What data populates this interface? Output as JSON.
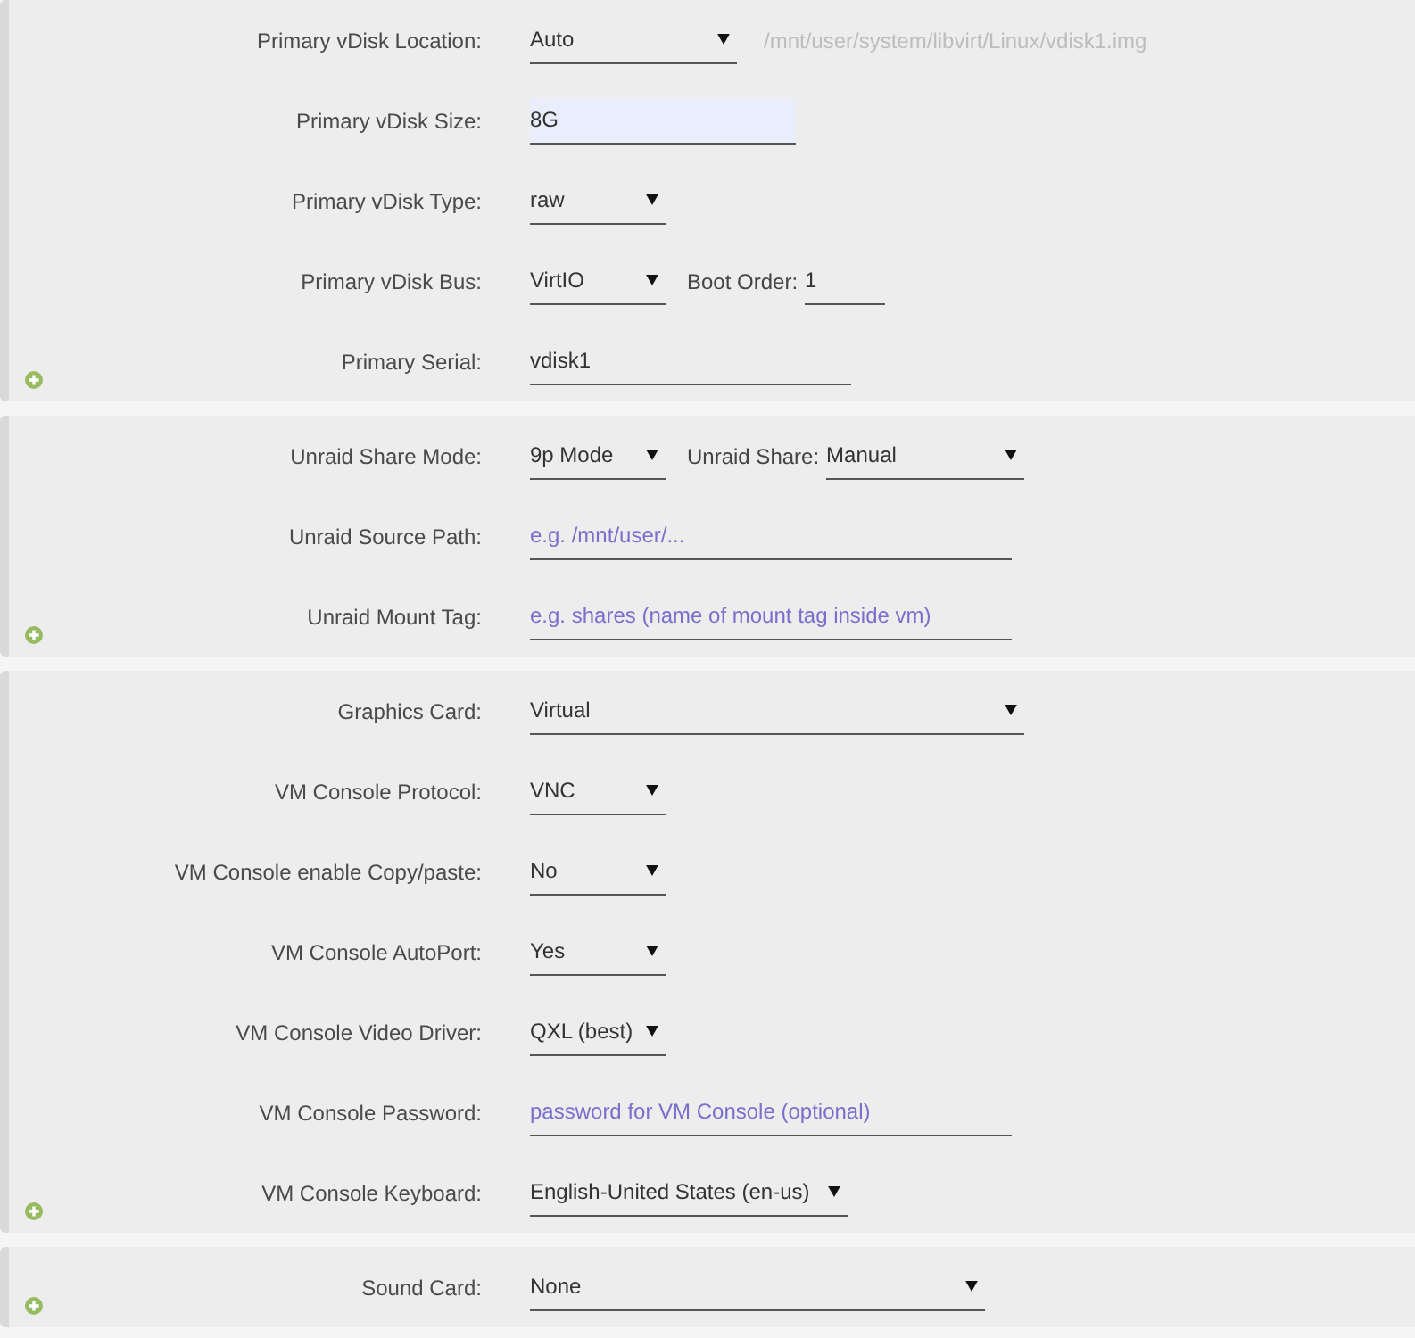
{
  "sections": [
    {
      "rows": [
        {
          "label": "Primary vDisk Location:",
          "controls": [
            {
              "kind": "select",
              "value": "Auto"
            },
            {
              "kind": "note",
              "text": "/mnt/user/system/libvirt/Linux/vdisk1.img"
            }
          ]
        },
        {
          "label": "Primary vDisk Size:",
          "controls": [
            {
              "kind": "input",
              "value": "8G",
              "highlighted": true
            }
          ]
        },
        {
          "label": "Primary vDisk Type:",
          "controls": [
            {
              "kind": "select",
              "value": "raw"
            }
          ]
        },
        {
          "label": "Primary vDisk Bus:",
          "controls": [
            {
              "kind": "select",
              "value": "VirtIO"
            },
            {
              "kind": "label",
              "text": "Boot Order:"
            },
            {
              "kind": "input",
              "value": "1",
              "highlighted": false
            }
          ]
        },
        {
          "label": "Primary Serial:",
          "controls": [
            {
              "kind": "input",
              "value": "vdisk1",
              "highlighted": false
            }
          ]
        }
      ]
    },
    {
      "rows": [
        {
          "label": "Unraid Share Mode:",
          "controls": [
            {
              "kind": "select",
              "value": "9p Mode"
            },
            {
              "kind": "label",
              "text": "Unraid Share:"
            },
            {
              "kind": "select",
              "value": "Manual"
            }
          ]
        },
        {
          "label": "Unraid Source Path:",
          "controls": [
            {
              "kind": "input",
              "placeholder": "e.g. /mnt/user/...",
              "highlighted": false
            }
          ]
        },
        {
          "label": "Unraid Mount Tag:",
          "controls": [
            {
              "kind": "input",
              "placeholder": "e.g. shares (name of mount tag inside vm)",
              "highlighted": false
            }
          ]
        }
      ]
    },
    {
      "rows": [
        {
          "label": "Graphics Card:",
          "controls": [
            {
              "kind": "select",
              "value": "Virtual"
            }
          ]
        },
        {
          "label": "VM Console Protocol:",
          "controls": [
            {
              "kind": "select",
              "value": "VNC"
            }
          ]
        },
        {
          "label": "VM Console enable Copy/paste:",
          "controls": [
            {
              "kind": "select",
              "value": "No"
            }
          ]
        },
        {
          "label": "VM Console AutoPort:",
          "controls": [
            {
              "kind": "select",
              "value": "Yes"
            }
          ]
        },
        {
          "label": "VM Console Video Driver:",
          "controls": [
            {
              "kind": "select",
              "value": "QXL (best)"
            }
          ]
        },
        {
          "label": "VM Console Password:",
          "controls": [
            {
              "kind": "input",
              "placeholder": "password for VM Console (optional)",
              "highlighted": false
            }
          ]
        },
        {
          "label": "VM Console Keyboard:",
          "controls": [
            {
              "kind": "select",
              "value": "English-United States (en-us)"
            }
          ]
        }
      ]
    },
    {
      "rows": [
        {
          "label": "Sound Card:",
          "controls": [
            {
              "kind": "select",
              "value": "None"
            }
          ]
        }
      ]
    }
  ]
}
